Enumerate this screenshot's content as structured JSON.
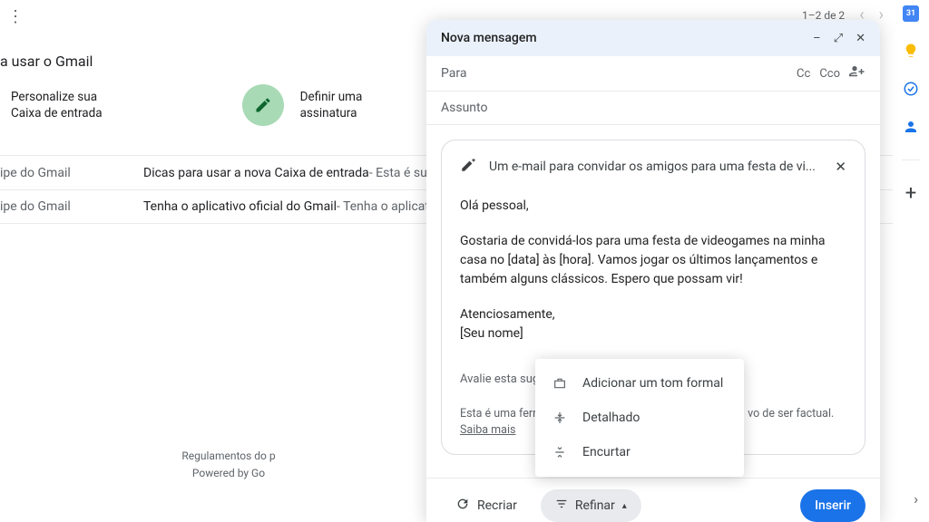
{
  "pagination": {
    "label": "1–2 de 2"
  },
  "sidepanel": {
    "calendar": "31"
  },
  "onboarding": {
    "title": "a usar o Gmail",
    "personalize": "Personalize sua\nCaixa de entrada",
    "signature": "Definir uma\nassinatura"
  },
  "mails": [
    {
      "sender": "ipe do Gmail",
      "subject": "Dicas para usar a nova Caixa de entrada",
      "snippet": " - Esta é su"
    },
    {
      "sender": "ipe do Gmail",
      "subject": "Tenha o aplicativo oficial do Gmail",
      "snippet": " - Tenha o aplicat"
    }
  ],
  "footer": {
    "line1": "Regulamentos do p",
    "line2": "Powered by Go"
  },
  "compose": {
    "title": "Nova mensagem",
    "to_label": "Para",
    "cc": "Cc",
    "bcc": "Cco",
    "subject_placeholder": "Assunto",
    "prompt": "Um e-mail para convidar os amigos para uma festa de vi...",
    "body": {
      "greeting": "Olá pessoal,",
      "para1": "Gostaria de convidá-los para uma festa de videogames na minha casa no [data] às [hora]. Vamos jogar os últimos lançamentos e também alguns clássicos. Espero que possam vir!",
      "signoff": "Atenciosamente,",
      "name": "[Seu nome]"
    },
    "rate_label": "Avalie esta sugestão:",
    "disclaimer_prefix": "Esta é uma ferra",
    "disclaimer_suffix": "vo de ser factual.",
    "learn_more": "Saiba mais",
    "recreate": "Recriar",
    "refine": "Refinar",
    "insert": "Inserir"
  },
  "refine_menu": {
    "formal": "Adicionar um tom formal",
    "detailed": "Detalhado",
    "shorten": "Encurtar"
  }
}
